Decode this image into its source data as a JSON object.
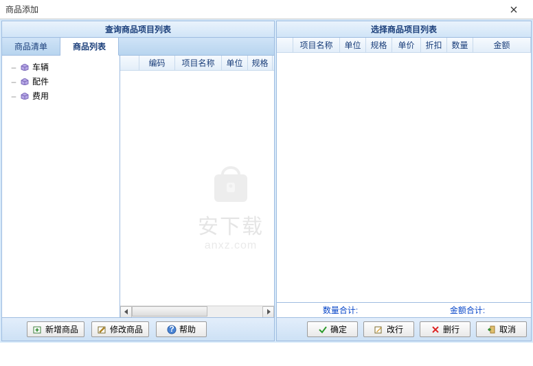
{
  "window": {
    "title": "商品添加"
  },
  "left": {
    "header": "查询商品项目列表",
    "tabs": {
      "list": "商品清单",
      "table": "商品列表"
    },
    "tree": {
      "items": [
        "车辆",
        "配件",
        "费用"
      ]
    },
    "grid": {
      "cols": [
        "",
        "编码",
        "项目名称",
        "单位",
        "规格"
      ]
    },
    "buttons": {
      "add": "新增商品",
      "edit": "修改商品",
      "help": "帮助"
    }
  },
  "right": {
    "header": "选择商品项目列表",
    "grid": {
      "cols": [
        "项目名称",
        "单位",
        "规格",
        "单价",
        "折扣",
        "数量",
        "金额"
      ]
    },
    "summary": {
      "qty": "数量合计:",
      "amt": "金额合计:"
    },
    "buttons": {
      "ok": "确定",
      "editrow": "改行",
      "delrow": "删行",
      "cancel": "取消"
    }
  },
  "watermark": {
    "line1": "安下载",
    "line2": "anxz.com"
  }
}
